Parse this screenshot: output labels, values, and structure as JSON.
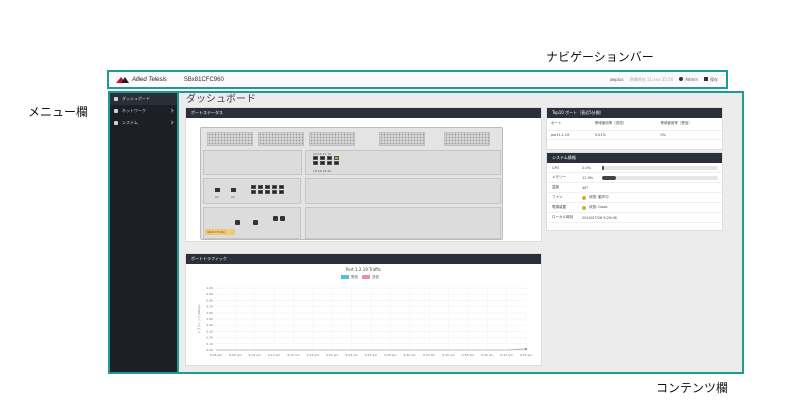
{
  "callouts": {
    "nav": "ナビゲーションバー",
    "menu": "メニュー欄",
    "content": "コンテンツ欄"
  },
  "navbar": {
    "logo_text": "Allied Telesis",
    "hostname": "SBx81CFC960",
    "user_short": "awplus",
    "server_time": "現場時刻 11:xxx:35:16",
    "admin_label": "Admin",
    "save_label": "保存"
  },
  "sidebar": {
    "items": [
      {
        "label": "ダッシュボード",
        "icon": "dashboard-icon"
      },
      {
        "label": "ネットワーク",
        "icon": "network-icon"
      },
      {
        "label": "システム",
        "icon": "gear-icon"
      }
    ]
  },
  "main": {
    "page_title": "ダッシュボード",
    "port_status": {
      "title": "ポートステータス",
      "port_labels_a": [
        "13",
        "14",
        "15",
        "16",
        "17",
        "18",
        "19",
        "20"
      ],
      "port_labels_b": [
        "11",
        "12"
      ],
      "port_labels_c": [
        "1",
        "2",
        "3",
        "4",
        "5",
        "6",
        "7",
        "8",
        "9",
        "10"
      ],
      "model_tag": "SBx81CFC960"
    },
    "top10": {
      "title": "Top10 ポート（直近5分間）",
      "headers": [
        "ポート",
        "帯域使用率（送信）",
        "帯域使用率（受信）"
      ],
      "rows": [
        [
          "port1.2.19",
          "0.01%",
          "0%"
        ]
      ]
    },
    "system_info": {
      "title": "システム情報",
      "cpu": {
        "label": "CPU",
        "value": "2.0%",
        "fraction": 0.02
      },
      "memory": {
        "label": "メモリー",
        "value": "11.9%",
        "fraction": 0.119
      },
      "temp": {
        "label": "温度",
        "value": "46°"
      },
      "fan": {
        "label": "ファン",
        "value": "状態: 動作中"
      },
      "power": {
        "label": "電源装置",
        "value": "状態: Good"
      },
      "uptime": {
        "label": "ローカル時刻",
        "value": "2019/07/26 9:29:06"
      }
    },
    "traffic": {
      "title": "ポートトラフィック"
    }
  },
  "chart_data": {
    "type": "line",
    "title": "Port 1.2.19 Traffic",
    "ylabel": "トラフィック (Mbps)",
    "ylim": [
      0,
      1
    ],
    "yticks": [
      "1.00",
      "0.90",
      "0.80",
      "0.70",
      "0.60",
      "0.50",
      "0.40",
      "0.30",
      "0.20",
      "0.10",
      "0.00"
    ],
    "categories": [
      "9:05 am",
      "9:06 am",
      "9:10 am",
      "9:13 am",
      "9:15 am",
      "9:18 am",
      "9:20 am",
      "9:23 am",
      "9:25 am",
      "9:28 am",
      "9:30 am",
      "9:33 am",
      "9:35 am",
      "9:38 am",
      "9:40 am",
      "9:43 am",
      "9:45 am"
    ],
    "series": [
      {
        "name": "受信",
        "color": "#4fc3c9",
        "values": [
          0,
          0,
          0,
          0,
          0,
          0,
          0,
          0,
          0,
          0,
          0,
          0,
          0,
          0,
          0,
          0,
          0.02
        ]
      },
      {
        "name": "送信",
        "color": "#e58bb6",
        "values": [
          0,
          0,
          0,
          0,
          0,
          0,
          0,
          0,
          0,
          0,
          0,
          0,
          0,
          0,
          0,
          0,
          0.01
        ]
      }
    ],
    "grid": true,
    "legend": "top"
  },
  "colors": {
    "highlight": "#1a9e93",
    "sidebar_bg": "#1c1f26",
    "panel_head": "#2b2f3a",
    "port_link": "#7bc043"
  }
}
